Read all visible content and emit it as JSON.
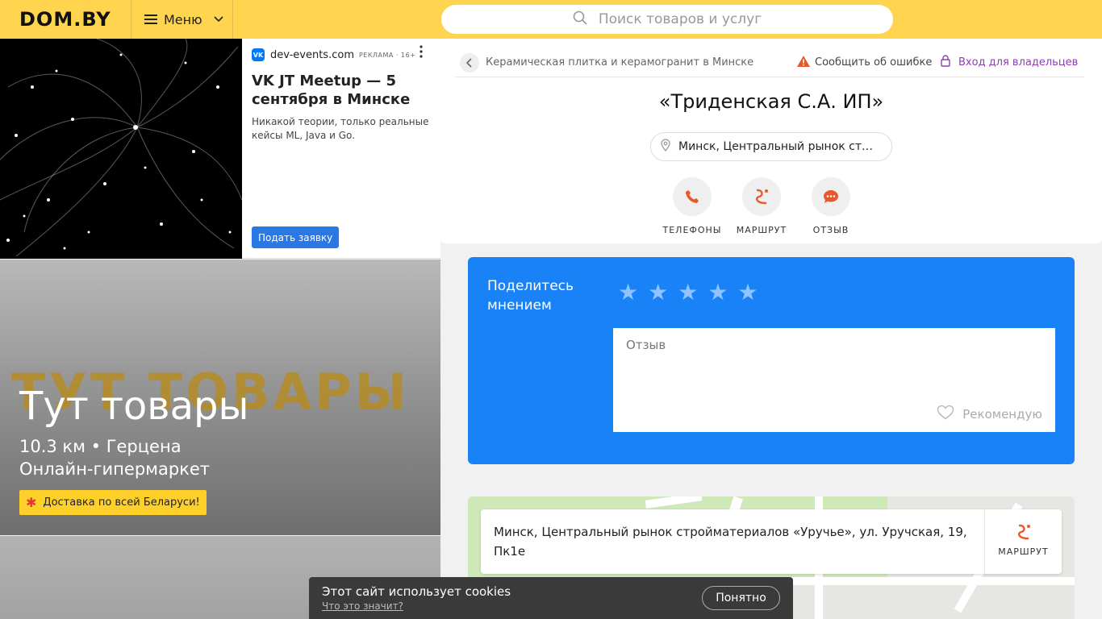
{
  "header": {
    "logo": "DOM.BY",
    "menu_label": "Меню",
    "search_placeholder": "Поиск товаров и услуг"
  },
  "ad": {
    "source": "dev-events.com",
    "vk_logo": "VK",
    "label": "РЕКЛАМА · 16+",
    "title": "VK JT Meetup — 5 сентября в Минске",
    "description": "Никакой теории, только реальные кейсы ML, Java и Go.",
    "button": "Подать заявку"
  },
  "promo": {
    "background_text": "ТУТ ТОВАРЫ",
    "title": "Тут товары",
    "distance_line": "10.3 км • Герцена",
    "subtitle": "Онлайн-гипермаркет",
    "badge": "Доставка по всей Беларуси!"
  },
  "breadcrumb": {
    "category": "Керамическая плитка и керамогранит в Минске",
    "report": "Сообщить об ошибке",
    "owner_login": "Вход для владельцев"
  },
  "company": {
    "name": "«Триденская С.А. ИП»",
    "address_short": "Минск, Центральный рынок стройматериалов «Уручье», ул. Уручская, 19, Пк1е"
  },
  "actions": [
    {
      "label": "ТЕЛЕФОНЫ",
      "icon": "phone-icon"
    },
    {
      "label": "МАРШРУТ",
      "icon": "route-icon"
    },
    {
      "label": "ОТЗЫВ",
      "icon": "chat-icon"
    }
  ],
  "review": {
    "title": "Поделитесь мнением",
    "stars_total": 5,
    "placeholder": "Отзыв",
    "recommend": "Рекомендую"
  },
  "map": {
    "address": "Минск, Центральный рынок стройматериалов «Уручье», ул. Уручская, 19, Пк1е",
    "route_label": "МАРШРУТ"
  },
  "cookie": {
    "text": "Этот сайт использует cookies",
    "link": "Что это значит?",
    "button": "Понятно"
  },
  "colors": {
    "header_bg": "#ffd54f",
    "accent_orange": "#e8582a",
    "review_blue": "#1a82f7",
    "owner_purple": "#8e3fb0"
  }
}
